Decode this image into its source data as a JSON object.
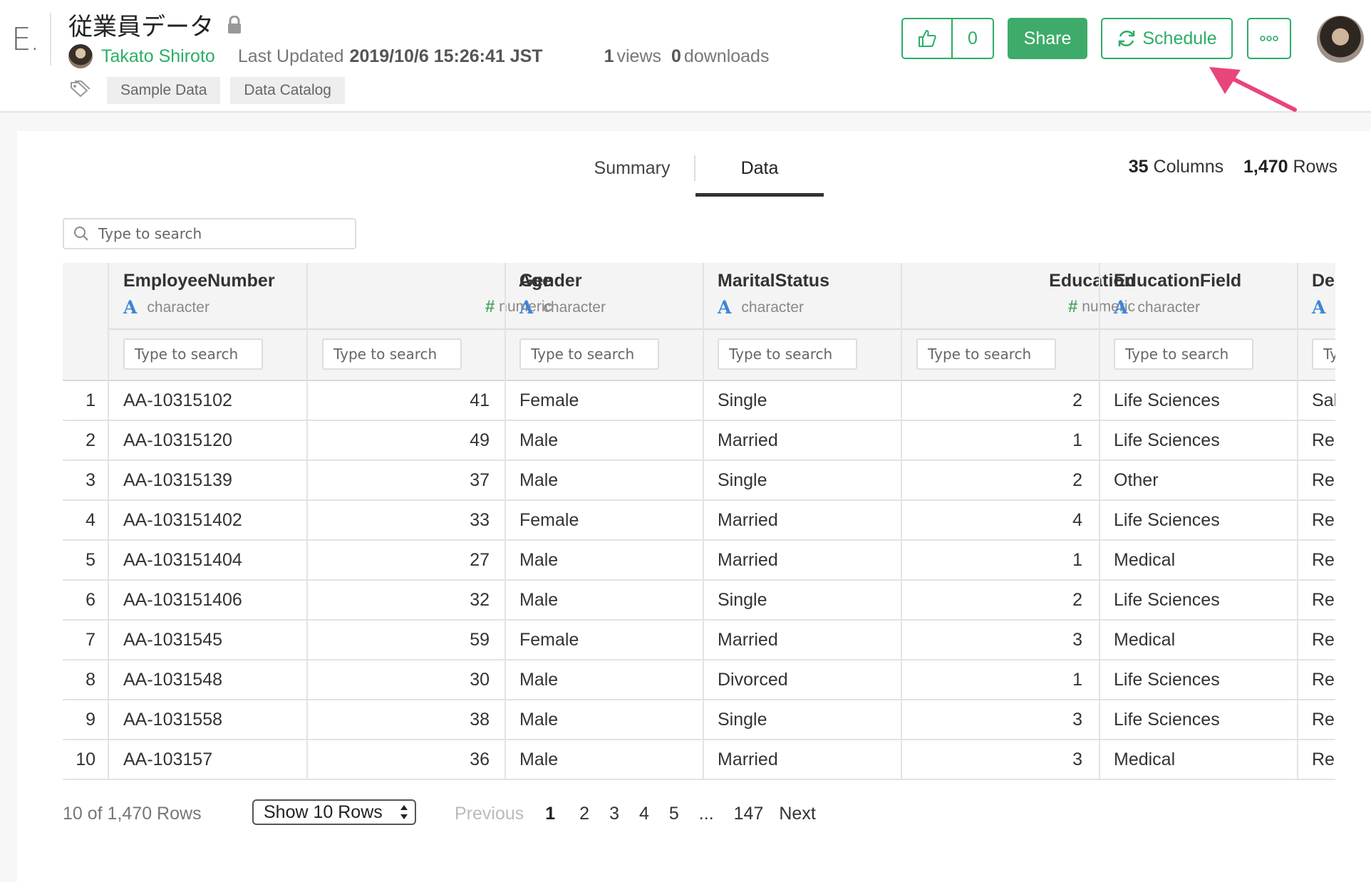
{
  "header": {
    "app_logo": "E.",
    "title": "従業員データ",
    "author": "Takato Shiroto",
    "updated_label": "Last Updated",
    "updated_value": "2019/10/6 15:26:41 JST",
    "views_count": "1",
    "views_label": "views",
    "downloads_count": "0",
    "downloads_label": "downloads",
    "tags": [
      "Sample Data",
      "Data Catalog"
    ],
    "like_count": "0",
    "share_label": "Share",
    "schedule_label": "Schedule",
    "icons": [
      "lock-icon",
      "tag-icon",
      "thumbs-up-icon",
      "refresh-icon",
      "more-icon"
    ],
    "colors": {
      "accent": "#2bae66",
      "share_bg": "#3eab6a",
      "annotation_arrow": "#e8457a"
    }
  },
  "tabs": [
    {
      "label": "Summary",
      "active": false
    },
    {
      "label": "Data",
      "active": true
    }
  ],
  "counts": {
    "columns_value": "35",
    "columns_label": "Columns",
    "rows_value": "1,470",
    "rows_label": "Rows"
  },
  "search": {
    "placeholder": "Type to search"
  },
  "table": {
    "columns": [
      {
        "name": "EmployeeNumber",
        "type_symbol": "A",
        "type_label": "character",
        "search_placeholder": "Type to search"
      },
      {
        "name": "Age",
        "type_symbol": "#",
        "type_label": "numeric",
        "search_placeholder": "Type to search"
      },
      {
        "name": "Gender",
        "type_symbol": "A",
        "type_label": "character",
        "search_placeholder": "Type to search"
      },
      {
        "name": "MaritalStatus",
        "type_symbol": "A",
        "type_label": "character",
        "search_placeholder": "Type to search"
      },
      {
        "name": "Education",
        "type_symbol": "#",
        "type_label": "numeric",
        "search_placeholder": "Type to search"
      },
      {
        "name": "EducationField",
        "type_symbol": "A",
        "type_label": "character",
        "search_placeholder": "Type to search"
      },
      {
        "name": "De",
        "type_symbol": "A",
        "type_label": "",
        "search_placeholder": "Ty"
      }
    ],
    "rows": [
      [
        "1",
        "AA-10315102",
        "41",
        "Female",
        "Single",
        "2",
        "Life Sciences",
        "Sal"
      ],
      [
        "2",
        "AA-10315120",
        "49",
        "Male",
        "Married",
        "1",
        "Life Sciences",
        "Res"
      ],
      [
        "3",
        "AA-10315139",
        "37",
        "Male",
        "Single",
        "2",
        "Other",
        "Res"
      ],
      [
        "4",
        "AA-103151402",
        "33",
        "Female",
        "Married",
        "4",
        "Life Sciences",
        "Res"
      ],
      [
        "5",
        "AA-103151404",
        "27",
        "Male",
        "Married",
        "1",
        "Medical",
        "Res"
      ],
      [
        "6",
        "AA-103151406",
        "32",
        "Male",
        "Single",
        "2",
        "Life Sciences",
        "Res"
      ],
      [
        "7",
        "AA-1031545",
        "59",
        "Female",
        "Married",
        "3",
        "Medical",
        "Res"
      ],
      [
        "8",
        "AA-1031548",
        "30",
        "Male",
        "Divorced",
        "1",
        "Life Sciences",
        "Res"
      ],
      [
        "9",
        "AA-1031558",
        "38",
        "Male",
        "Single",
        "3",
        "Life Sciences",
        "Res"
      ],
      [
        "10",
        "AA-103157",
        "36",
        "Male",
        "Married",
        "3",
        "Medical",
        "Res"
      ]
    ]
  },
  "footer": {
    "rows_info": "10 of 1,470 Rows",
    "rows_select": "Show 10 Rows",
    "previous": "Previous",
    "pages": [
      "1",
      "2",
      "3",
      "4",
      "5",
      "...",
      "147"
    ],
    "current_page": "1",
    "next": "Next"
  }
}
